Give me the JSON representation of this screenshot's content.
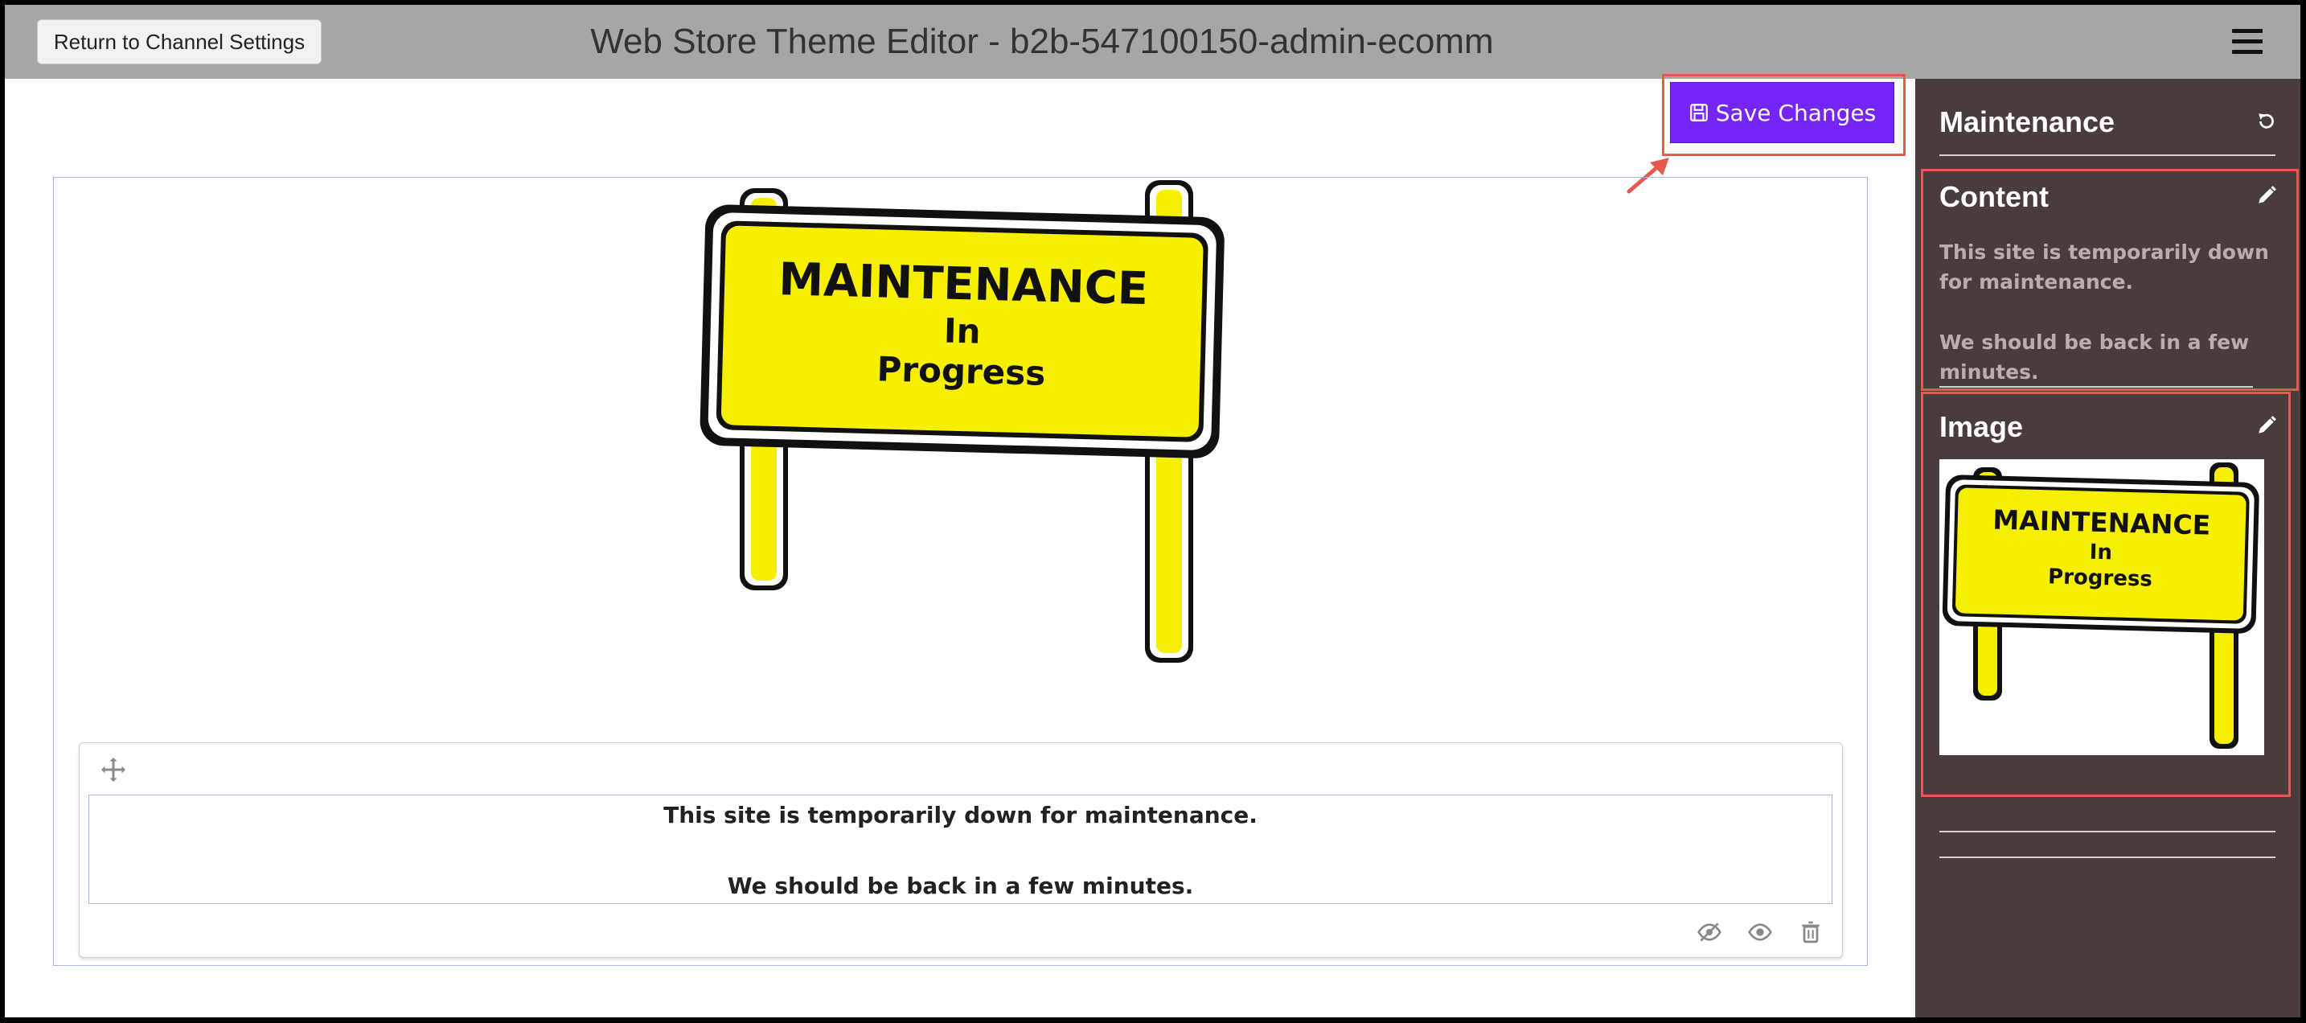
{
  "header": {
    "return_label": "Return to Channel Settings",
    "title": "Web Store Theme Editor - b2b-547100150-admin-ecomm",
    "menu_icon": "hamburger-menu-icon"
  },
  "toolbar": {
    "save_label": "Save Changes",
    "save_icon": "floppy-disk-icon"
  },
  "canvas": {
    "sign_image": {
      "line1": "MAINTENANCE",
      "line2": "In",
      "line3": "Progress"
    },
    "content_block": {
      "line1": "This site is temporarily down for maintenance.",
      "line2": "We should be back in a few minutes.",
      "icons": [
        "move-icon",
        "hide-icon",
        "preview-icon",
        "trash-icon"
      ]
    }
  },
  "sidebar": {
    "maintenance_title": "Maintenance",
    "content_title": "Content",
    "content_text_1": "This site is temporarily down for maintenance.",
    "content_text_2": "We should be back in a few minutes.",
    "image_title": "Image"
  },
  "colors": {
    "header_bg": "#a6a6a6",
    "accent": "#7526f7",
    "sidebar_bg": "#4a3c3c",
    "highlight": "#e55a4e"
  }
}
